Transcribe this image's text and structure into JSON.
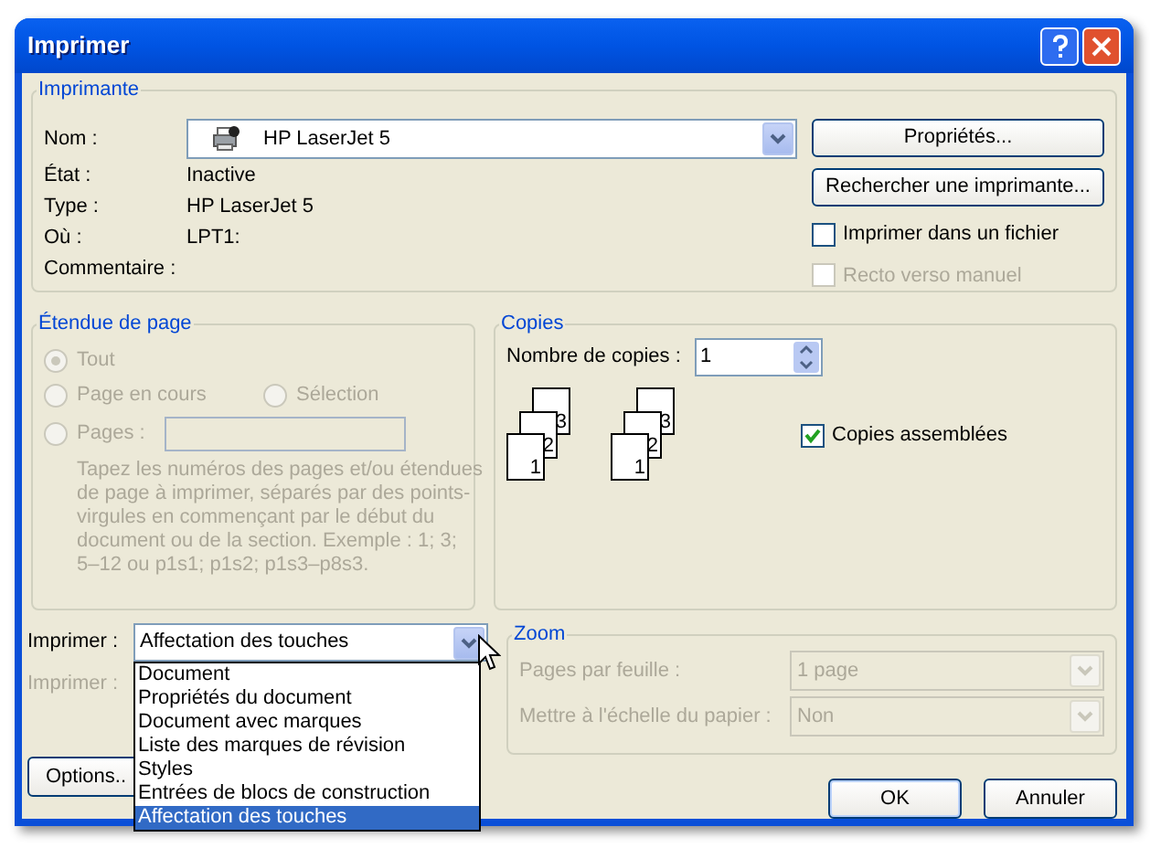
{
  "window": {
    "title": "Imprimer"
  },
  "printer": {
    "legend": "Imprimante",
    "name_label": "Nom :",
    "name_value": "HP LaserJet 5",
    "fields": [
      {
        "label": "État :",
        "value": "Inactive"
      },
      {
        "label": "Type :",
        "value": "HP LaserJet 5"
      },
      {
        "label": "Où :",
        "value": "LPT1:"
      },
      {
        "label": "Commentaire :"
      }
    ],
    "properties_button": "Propriétés...",
    "find_button": "Rechercher une imprimante...",
    "checkboxes": [
      {
        "label": "Imprimer dans un fichier",
        "checked": false,
        "disabled": false
      },
      {
        "label": "Recto verso manuel",
        "checked": false,
        "disabled": true
      }
    ]
  },
  "page_range": {
    "legend": "Étendue de page",
    "disabled": true,
    "options": [
      {
        "label": "Tout",
        "selected": true
      },
      {
        "label": "Page en cours",
        "selected": false
      },
      {
        "label": "Sélection",
        "selected": false
      },
      {
        "label": "Pages :",
        "selected": false
      }
    ],
    "hint": "Tapez les numéros des pages et/ou étendues de page à imprimer, séparés par des points-virgules en commençant par le début du document ou de la section. Exemple : 1; 3; 5–12 ou p1s1; p1s2; p1s3–p8s3."
  },
  "copies": {
    "legend": "Copies",
    "count_label": "Nombre de copies :",
    "count_value": "1",
    "stacks": [
      [
        "1",
        "2",
        "3"
      ],
      [
        "1",
        "2",
        "3"
      ]
    ],
    "collate": {
      "label": "Copies assemblées",
      "checked": true
    }
  },
  "print_what": {
    "label": "Imprimer :",
    "value": "Affectation des touches",
    "expanded": true,
    "list": [
      {
        "label": "Document",
        "selected": false
      },
      {
        "label": "Propriétés du document",
        "selected": false
      },
      {
        "label": "Document avec marques",
        "selected": false
      },
      {
        "label": "Liste des marques de révision",
        "selected": false
      },
      {
        "label": "Styles",
        "selected": false
      },
      {
        "label": "Entrées de blocs de construction",
        "selected": false
      },
      {
        "label": "Affectation des touches",
        "selected": true
      }
    ]
  },
  "print_second": {
    "label": "Imprimer :",
    "disabled": true
  },
  "zoom": {
    "legend": "Zoom",
    "disabled": true,
    "rows": [
      {
        "label": "Pages par feuille :",
        "value": "1 page"
      },
      {
        "label": "Mettre à l'échelle du papier :",
        "value": "Non"
      }
    ]
  },
  "buttons": {
    "options": "Options..",
    "ok": "OK",
    "cancel": "Annuler"
  }
}
